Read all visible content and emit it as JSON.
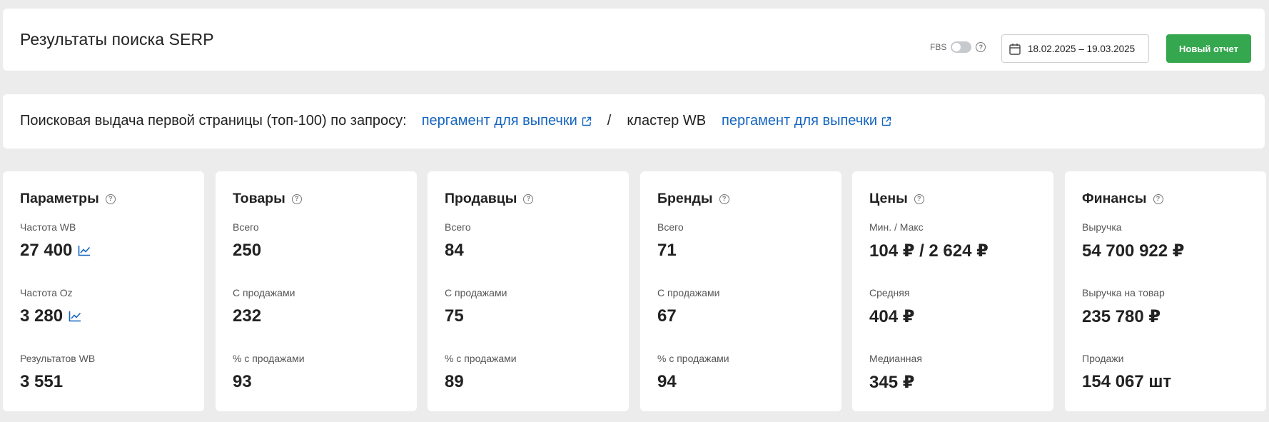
{
  "header": {
    "title": "Результаты поиска SERP",
    "fbs_label": "FBS",
    "fbs_enabled": false,
    "date_range": "18.02.2025 – 19.03.2025",
    "new_report_label": "Новый отчет"
  },
  "query": {
    "prefix": "Поисковая выдача первой страницы (топ-100) по запросу:",
    "query_link": "пергамент для выпечки",
    "separator": "/",
    "cluster_label": "кластер WB",
    "cluster_link": "пергамент для выпечки"
  },
  "cards": [
    {
      "title": "Параметры",
      "stats": [
        {
          "label": "Частота WB",
          "value": "27 400",
          "trend_icon": true
        },
        {
          "label": "Частота Oz",
          "value": "3 280",
          "trend_icon": true
        },
        {
          "label": "Результатов WB",
          "value": "3 551",
          "trend_icon": false
        }
      ]
    },
    {
      "title": "Товары",
      "stats": [
        {
          "label": "Всего",
          "value": "250"
        },
        {
          "label": "С продажами",
          "value": "232"
        },
        {
          "label": "% с продажами",
          "value": "93"
        }
      ]
    },
    {
      "title": "Продавцы",
      "stats": [
        {
          "label": "Всего",
          "value": "84"
        },
        {
          "label": "С продажами",
          "value": "75"
        },
        {
          "label": "% с продажами",
          "value": "89"
        }
      ]
    },
    {
      "title": "Бренды",
      "stats": [
        {
          "label": "Всего",
          "value": "71"
        },
        {
          "label": "С продажами",
          "value": "67"
        },
        {
          "label": "% с продажами",
          "value": "94"
        }
      ]
    },
    {
      "title": "Цены",
      "stats": [
        {
          "label": "Мин. / Макс",
          "value": "104 ₽ / 2 624 ₽"
        },
        {
          "label": "Средняя",
          "value": "404 ₽"
        },
        {
          "label": "Медианная",
          "value": "345 ₽"
        }
      ]
    },
    {
      "title": "Финансы",
      "stats": [
        {
          "label": "Выручка",
          "value": "54 700 922 ₽"
        },
        {
          "label": "Выручка на товар",
          "value": "235 780 ₽"
        },
        {
          "label": "Продажи",
          "value": "154 067 шт"
        }
      ]
    }
  ],
  "colors": {
    "accent_link": "#1565c0",
    "primary_button": "#35a74f",
    "background": "#ececec"
  }
}
